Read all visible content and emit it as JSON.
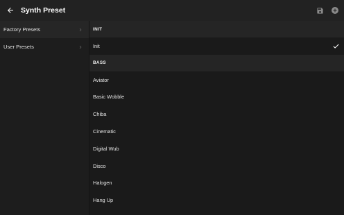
{
  "header": {
    "title": "Synth Preset",
    "back_icon": "arrow-back-icon",
    "save_icon": "save-icon",
    "add_icon": "add-circle-icon"
  },
  "sidebar": {
    "items": [
      {
        "label": "Factory Presets",
        "icon": "chevron-right-icon"
      },
      {
        "label": "User Presets",
        "icon": "chevron-right-icon"
      }
    ]
  },
  "main": {
    "sections": [
      {
        "header": "INIT",
        "presets": [
          {
            "label": "Init",
            "selected": true
          }
        ]
      },
      {
        "header": "BASS",
        "presets": [
          {
            "label": "Aviator"
          },
          {
            "label": "Basic Wobble"
          },
          {
            "label": "Chiba"
          },
          {
            "label": "Cinematic"
          },
          {
            "label": "Digital Wub"
          },
          {
            "label": "Disco"
          },
          {
            "label": "Halogen"
          },
          {
            "label": "Hang Up"
          }
        ]
      }
    ]
  },
  "colors": {
    "background": "#1a1a1a",
    "topbar": "#222222",
    "section": "#252525",
    "text": "#e6e6e6"
  }
}
